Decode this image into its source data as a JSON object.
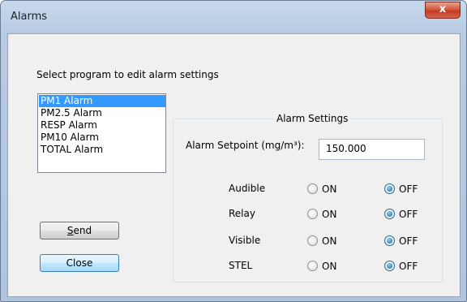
{
  "window": {
    "title": "Alarms",
    "close_glyph": "x"
  },
  "prompt": "Select program to edit alarm settings",
  "programs": [
    "PM1 Alarm",
    "PM2.5 Alarm",
    "RESP Alarm",
    "PM10 Alarm",
    "TOTAL Alarm"
  ],
  "selected_program": "PM1 Alarm",
  "alarm_settings": {
    "group_title": "Alarm Settings",
    "setpoint_label": "Alarm Setpoint (mg/m³):",
    "setpoint_value": "150.000",
    "on_label": "ON",
    "off_label": "OFF",
    "rows": [
      {
        "label": "Audible",
        "state": "OFF"
      },
      {
        "label": "Relay",
        "state": "OFF"
      },
      {
        "label": "Visible",
        "state": "OFF"
      },
      {
        "label": "STEL",
        "state": "OFF"
      }
    ]
  },
  "buttons": {
    "send": "Send",
    "close": "Close"
  }
}
